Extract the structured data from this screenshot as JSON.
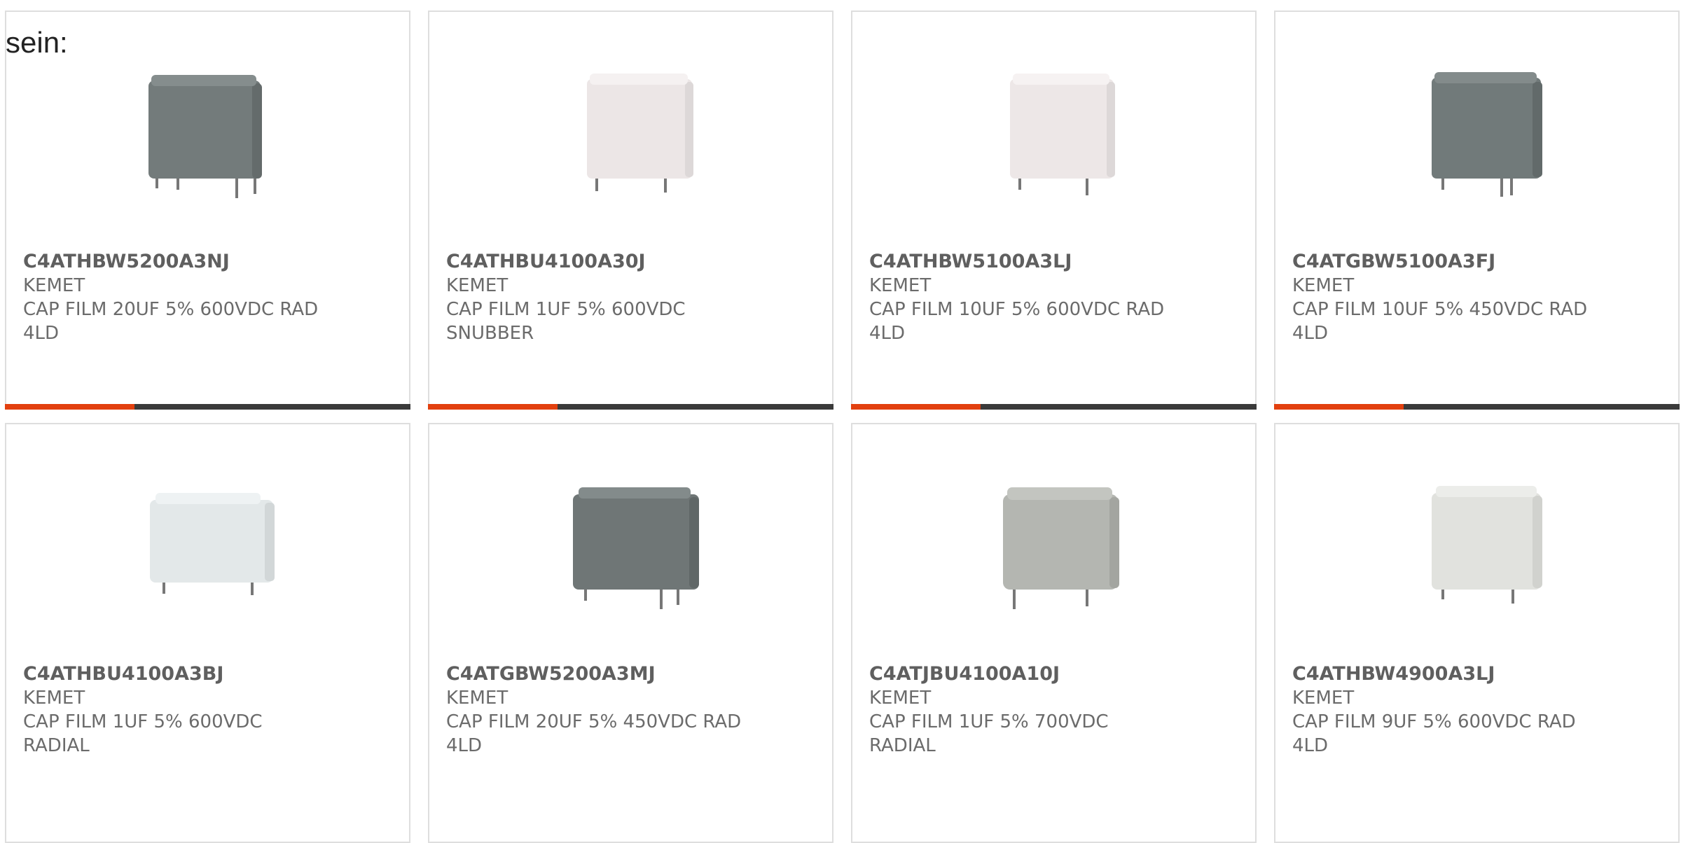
{
  "intro_text": "sein:",
  "accent_color": "#e2400f",
  "track_color": "#3a3a3a",
  "products": [
    {
      "part_number": "C4ATHBW5200A3NJ",
      "manufacturer": "KEMET",
      "description": "CAP FILM 20UF 5% 600VDC RAD 4LD",
      "image": "capacitor-image",
      "body_color": "#737b7b",
      "shows_progress": true,
      "progress": 0.32
    },
    {
      "part_number": "C4ATHBU4100A30J",
      "manufacturer": "KEMET",
      "description": "CAP FILM 1UF 5% 600VDC SNUBBER",
      "image": "capacitor-image",
      "body_color": "#ece6e6",
      "shows_progress": true,
      "progress": 0.32
    },
    {
      "part_number": "C4ATHBW5100A3LJ",
      "manufacturer": "KEMET",
      "description": "CAP FILM 10UF 5% 600VDC RAD 4LD",
      "image": "capacitor-image",
      "body_color": "#ede7e7",
      "shows_progress": true,
      "progress": 0.32
    },
    {
      "part_number": "C4ATGBW5100A3FJ",
      "manufacturer": "KEMET",
      "description": "CAP FILM 10UF 5% 450VDC RAD 4LD",
      "image": "capacitor-image",
      "body_color": "#717a7a",
      "shows_progress": true,
      "progress": 0.32
    },
    {
      "part_number": "C4ATHBU4100A3BJ",
      "manufacturer": "KEMET",
      "description": "CAP FILM 1UF 5% 600VDC RADIAL",
      "image": "capacitor-image",
      "body_color": "#e3e8e9",
      "shows_progress": false,
      "progress": 0
    },
    {
      "part_number": "C4ATGBW5200A3MJ",
      "manufacturer": "KEMET",
      "description": "CAP FILM 20UF 5% 450VDC RAD 4LD",
      "image": "capacitor-image",
      "body_color": "#6f7676",
      "shows_progress": false,
      "progress": 0
    },
    {
      "part_number": "C4ATJBU4100A10J",
      "manufacturer": "KEMET",
      "description": "CAP FILM 1UF 5% 700VDC RADIAL",
      "image": "capacitor-image",
      "body_color": "#b4b6b1",
      "shows_progress": false,
      "progress": 0
    },
    {
      "part_number": "C4ATHBW4900A3LJ",
      "manufacturer": "KEMET",
      "description": "CAP FILM 9UF 5% 600VDC RAD 4LD",
      "image": "capacitor-image",
      "body_color": "#e1e2de",
      "shows_progress": false,
      "progress": 0
    }
  ]
}
